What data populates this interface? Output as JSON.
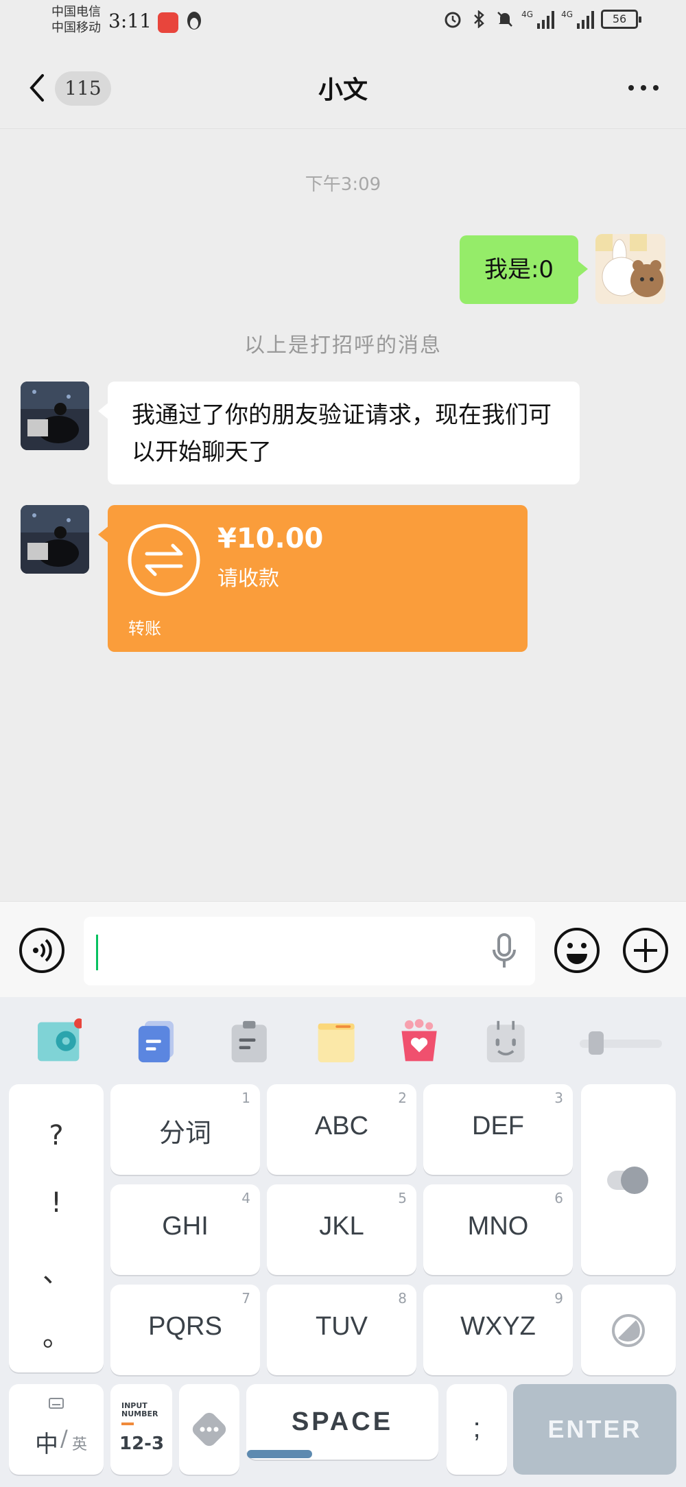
{
  "status_bar": {
    "carrier_1": "中国电信",
    "carrier_2": "中国移动",
    "time": "3:11",
    "network_1": "4G",
    "network_2": "4G",
    "battery": "56"
  },
  "nav": {
    "back_icon": "chevron-left-icon",
    "unread_count": "115",
    "title": "小文",
    "more_icon": "more-dots-icon"
  },
  "chat": {
    "timestamp": "下午3:09",
    "messages": [
      {
        "side": "right",
        "type": "text",
        "text": "我是:0"
      },
      {
        "side": "center",
        "type": "system",
        "text": "以上是打招呼的消息"
      },
      {
        "side": "left",
        "type": "text",
        "text": "我通过了你的朋友验证请求，现在我们可以开始聊天了"
      },
      {
        "side": "left",
        "type": "transfer",
        "amount": "¥10.00",
        "note": "请收款",
        "label": "转账"
      }
    ]
  },
  "input_bar": {
    "voice_icon": "voice-icon",
    "mic_icon": "microphone-icon",
    "emoji_icon": "emoji-icon",
    "plus_icon": "plus-icon"
  },
  "keyboard": {
    "toolbar": [
      "settings-icon",
      "clipboard-doc-icon",
      "clipboard-icon",
      "note-icon",
      "gift-heart-icon",
      "face-icon"
    ],
    "punctuation": [
      "?",
      "!",
      "、",
      "。"
    ],
    "keys": [
      {
        "label": "分词",
        "num": "1"
      },
      {
        "label": "ABC",
        "num": "2"
      },
      {
        "label": "DEF",
        "num": "3"
      },
      {
        "label": "GHI",
        "num": "4"
      },
      {
        "label": "JKL",
        "num": "5"
      },
      {
        "label": "MNO",
        "num": "6"
      },
      {
        "label": "PQRS",
        "num": "7"
      },
      {
        "label": "TUV",
        "num": "8"
      },
      {
        "label": "WXYZ",
        "num": "9"
      }
    ],
    "lang_main": "中",
    "lang_alt": "英",
    "number_mode_caption": "INPUT NUMBER",
    "number_mode": "12-3",
    "space": "SPACE",
    "semicolon": ";",
    "enter": "ENTER"
  }
}
